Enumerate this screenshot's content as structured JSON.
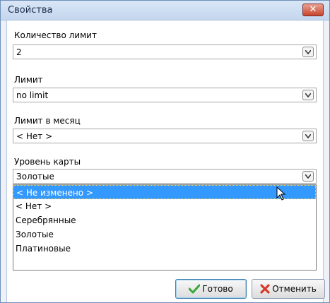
{
  "window": {
    "title": "Свойства"
  },
  "fields": [
    {
      "label": "Количество лимит",
      "value": "2"
    },
    {
      "label": "Лимит",
      "value": "no limit"
    },
    {
      "label": "Лимит в месяц",
      "value": "< Нет >"
    },
    {
      "label": "Уровень карты",
      "value": "Золотые"
    }
  ],
  "dropdown": {
    "options": [
      "< Не изменено >",
      "< Нет >",
      "Серебрянные",
      "Золотые",
      "Платиновые"
    ],
    "highlighted_index": 0
  },
  "buttons": {
    "ok": "Готово",
    "cancel": "Отменить"
  },
  "colors": {
    "highlight": "#3399ff",
    "close": "#c6452d"
  },
  "icons": [
    "close-icon",
    "chevron-down-icon",
    "checkmark-icon",
    "cancel-x-icon",
    "mouse-pointer-icon"
  ]
}
